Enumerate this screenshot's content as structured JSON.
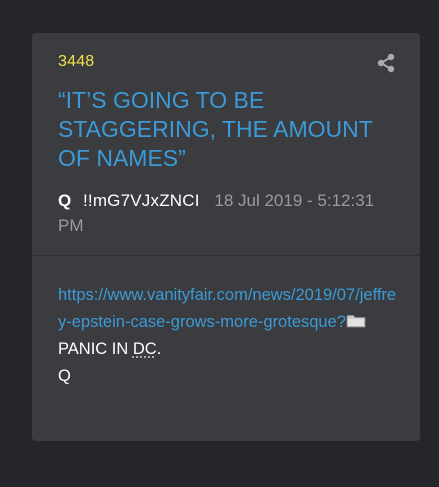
{
  "post": {
    "number": "3448",
    "title": "“IT’S GOING TO BE STAGGERING, THE AMOUNT OF NAMES”",
    "author": "Q",
    "tripcode": "!!mG7VJxZNCI",
    "date": "18 Jul 2019 - 5:12:31 PM",
    "link": "https://www.vanityfair.com/news/2019/07/jeffrey-epstein-case-grows-more-grotesque?",
    "line_panic_prefix": "PANIC IN ",
    "line_panic_dc": "DC",
    "line_panic_suffix": ".",
    "signature": "Q"
  },
  "icons": {
    "share": "share-icon",
    "folder": "folder-icon"
  },
  "colors": {
    "background": "#24262b",
    "card": "#3a3c40",
    "post_number": "#f2e34b",
    "title": "#3c9bd6",
    "link": "#3c9bd6",
    "date": "#9a9ca0",
    "text": "#ffffff"
  }
}
